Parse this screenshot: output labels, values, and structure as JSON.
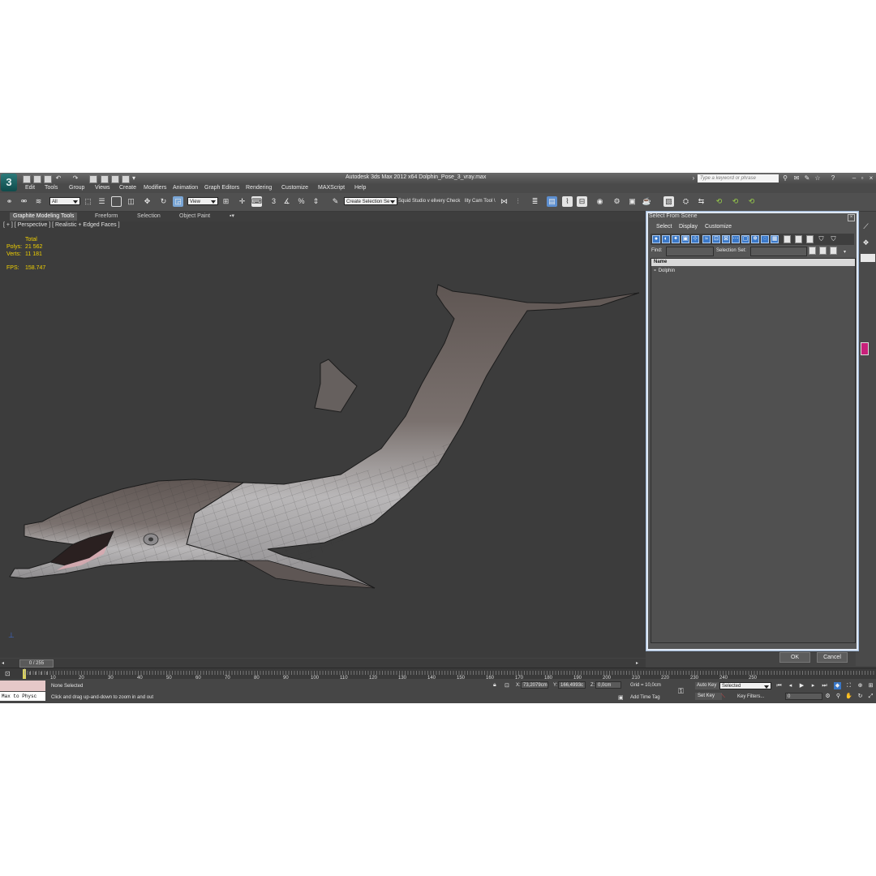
{
  "app": {
    "title": "Autodesk 3ds Max  2012 x64     Dolphin_Pose_3_vray.max",
    "logo": "3",
    "help_search_placeholder": "Type a keyword or phrase"
  },
  "menu": [
    "Edit",
    "Tools",
    "Group",
    "Views",
    "Create",
    "Modifiers",
    "Animation",
    "Graph Editors",
    "Rendering",
    "Customize",
    "MAXScript",
    "Help"
  ],
  "toolbar": {
    "filter_value": "All",
    "refcoord_value": "View",
    "angle_snap": "3",
    "named_selection_value": "Create Selection Se",
    "text_1": "Squid Studio v elivery Check",
    "text_2": "lity Cam Tool \\"
  },
  "ribbon": {
    "tabs": [
      "Graphite Modeling Tools",
      "Freeform",
      "Selection",
      "Object Paint"
    ]
  },
  "viewport": {
    "label": "[ + ] [ Perspective ] [ Realistic + Edged Faces ]",
    "stats_header": "Total",
    "polys_label": "Polys:",
    "polys_value": "21 562",
    "verts_label": "Verts:",
    "verts_value": "11 181",
    "fps_label": "FPS:",
    "fps_value": "158.747"
  },
  "dialog": {
    "title": "Select From Scene",
    "menus": [
      "Select",
      "Display",
      "Customize"
    ],
    "find_label": "Find:",
    "selection_set_label": "Selection Set:",
    "column_header": "Name",
    "items": [
      "Dolphin"
    ],
    "ok_label": "OK",
    "cancel_label": "Cancel"
  },
  "timeline": {
    "frame_indicator": "0 / 255",
    "ticks": [
      "10",
      "20",
      "30",
      "40",
      "50",
      "60",
      "70",
      "80",
      "90",
      "100",
      "110",
      "120",
      "130",
      "140",
      "150",
      "160",
      "170",
      "180",
      "190",
      "200",
      "210",
      "220",
      "230",
      "240",
      "250"
    ]
  },
  "status": {
    "listener_text": "Max to Physc",
    "selection_status": "None Selected",
    "prompt": "Click and drag up-and-down to zoom in and out",
    "x_label": "X:",
    "x_value": "73,2079cm",
    "y_label": "Y:",
    "y_value": "166,4993c",
    "z_label": "Z:",
    "z_value": "0,0cm",
    "grid": "Grid = 10,0cm",
    "add_time_tag": "Add Time Tag",
    "auto_key": "Auto Key",
    "set_key": "Set Key",
    "key_mode_value": "Selected",
    "key_filters": "Key Filters...",
    "current_frame": "0"
  }
}
